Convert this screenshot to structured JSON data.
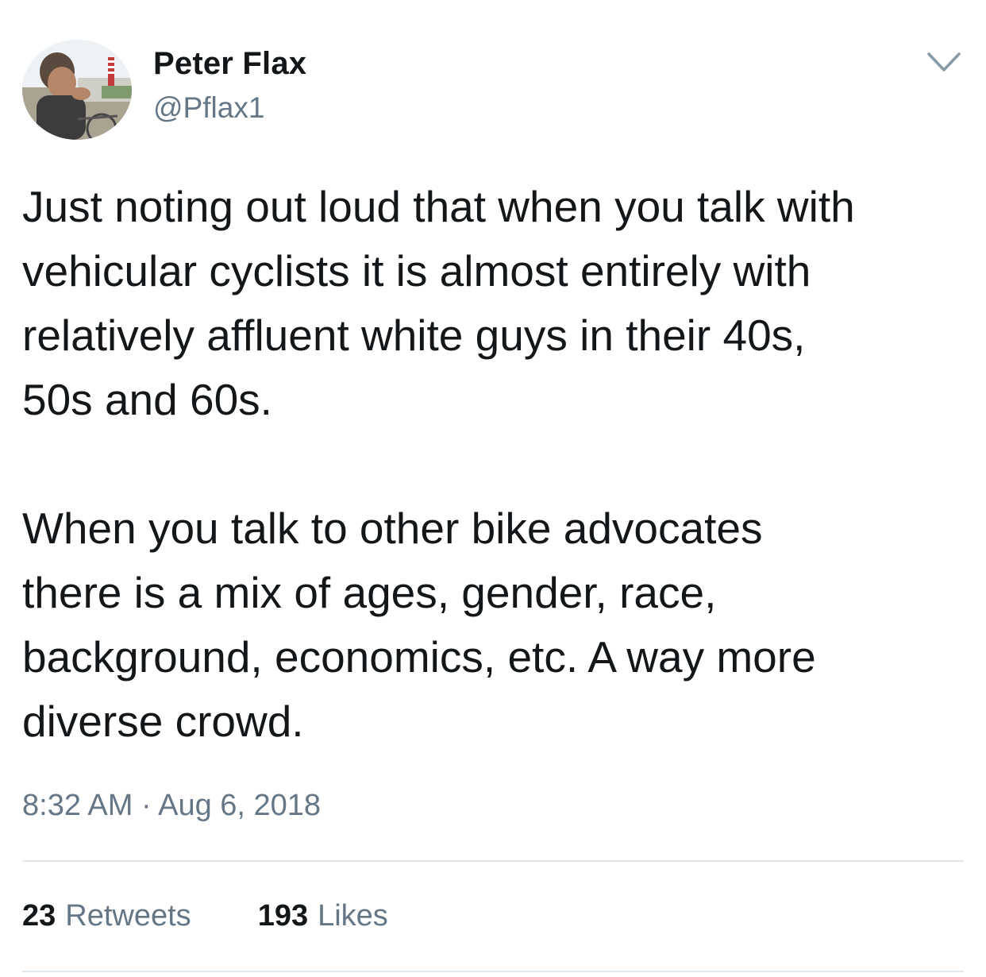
{
  "author": {
    "name": "Peter Flax",
    "handle": "@Pflax1"
  },
  "icons": {
    "avatar": "profile-photo",
    "menu": "chevron-down-icon"
  },
  "tweet": {
    "paragraphs": [
      {
        "lines": [
          "Just noting out loud that when you talk with",
          "vehicular cyclists it is almost entirely with",
          "relatively affluent white guys in their 40s,",
          "50s and 60s."
        ]
      },
      {
        "lines": [
          "When you talk to other bike advocates",
          "there is a mix of ages, gender, race,",
          "background, economics, etc. A way more",
          "diverse crowd."
        ]
      }
    ],
    "timestamp": "8:32 AM · Aug 6, 2018"
  },
  "stats": {
    "retweets_count": "23",
    "retweets_label": "Retweets",
    "likes_count": "193",
    "likes_label": "Likes"
  },
  "colors": {
    "text": "#14171a",
    "secondary": "#657786",
    "divider": "#e1e8ed"
  }
}
